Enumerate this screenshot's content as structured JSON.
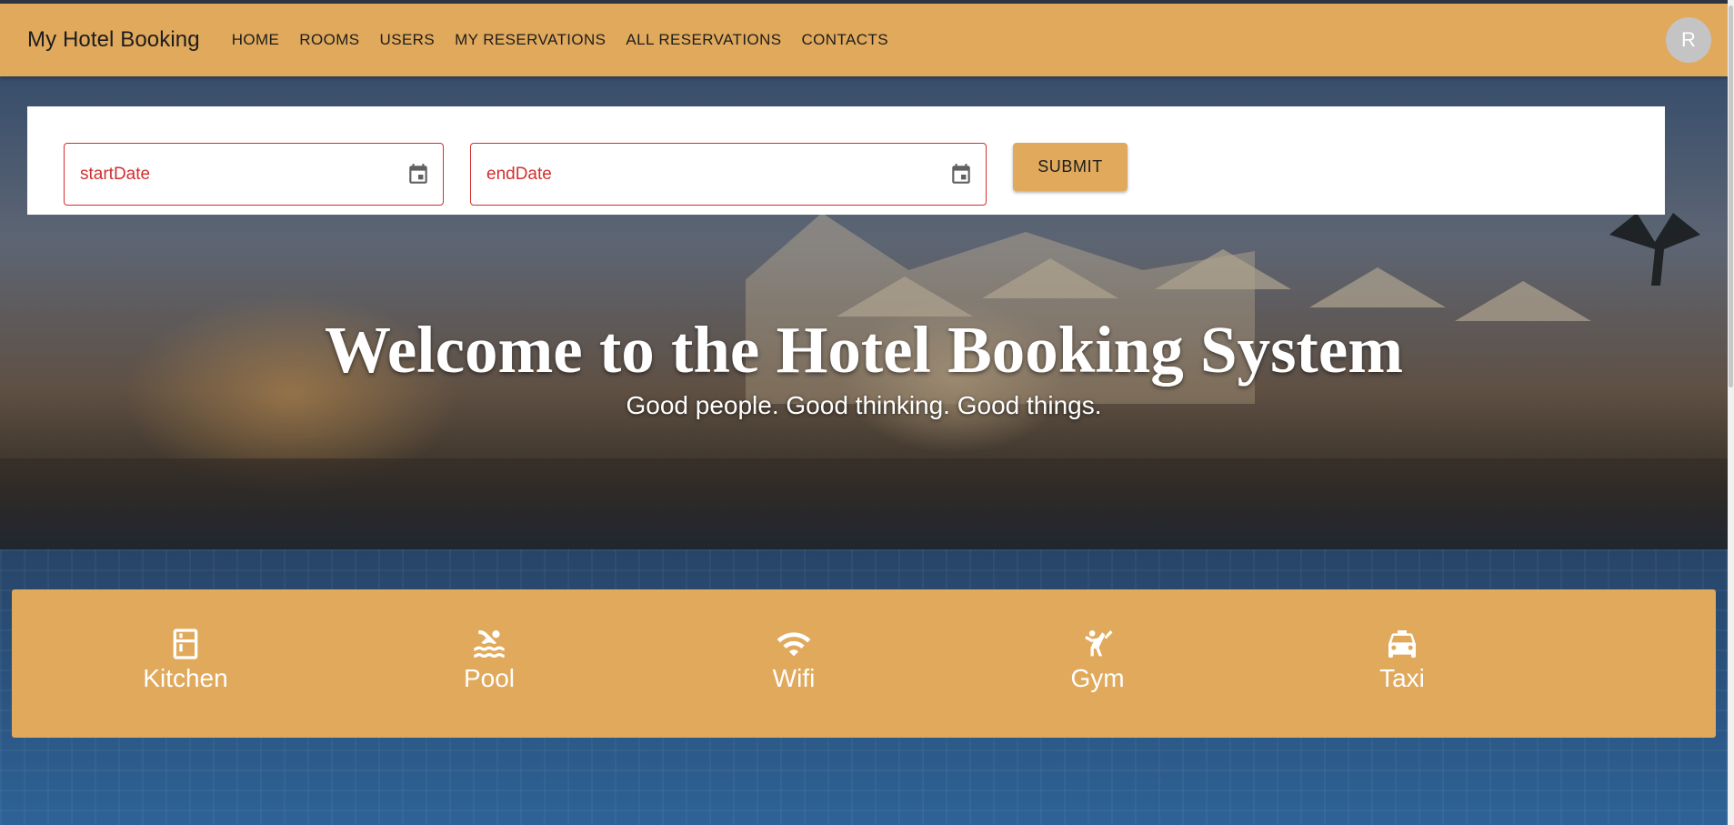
{
  "app": {
    "brand": "My Hotel Booking",
    "nav": [
      "HOME",
      "ROOMS",
      "USERS",
      "MY RESERVATIONS",
      "ALL RESERVATIONS",
      "CONTACTS"
    ],
    "avatar_initial": "R"
  },
  "search": {
    "start_placeholder": "startDate",
    "end_placeholder": "endDate",
    "submit_label": "SUBMIT"
  },
  "hero": {
    "title": "Welcome to the Hotel Booking System",
    "subtitle": "Good people. Good thinking. Good things."
  },
  "amenities": [
    {
      "label": "Kitchen",
      "icon": "kitchen-icon"
    },
    {
      "label": "Pool",
      "icon": "pool-icon"
    },
    {
      "label": "Wifi",
      "icon": "wifi-icon"
    },
    {
      "label": "Gym",
      "icon": "gym-icon"
    },
    {
      "label": "Taxi",
      "icon": "taxi-icon"
    }
  ],
  "colors": {
    "primary": "#e0a95c",
    "error": "#d32f2f",
    "avatar_bg": "#c4c4c4"
  }
}
